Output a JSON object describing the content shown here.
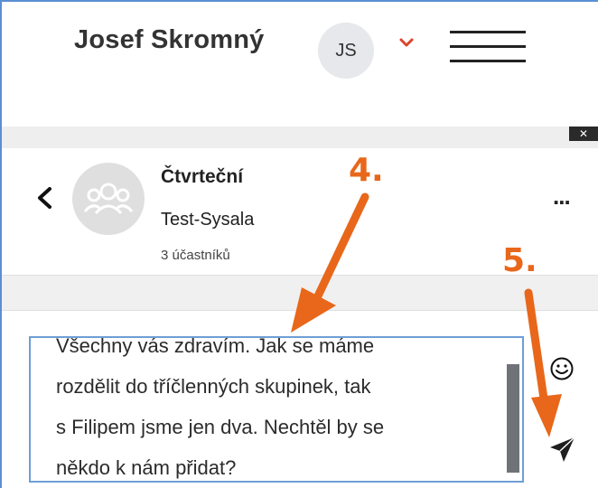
{
  "header": {
    "user_name": "Josef Skromný",
    "avatar_initials": "JS"
  },
  "chat": {
    "group_name": "Čtvrteční",
    "group_subtitle": "Test-Sysala",
    "participants": "3 účastníků",
    "more_label": "..."
  },
  "composer": {
    "text": "Všechny vás zdravím. Jak se máme\nrozdělit do tříčlenných skupinek, tak\ns Filipem jsme jen dva. Nechtěl by se\nněkdo k nám přidat?"
  },
  "annotations": {
    "step4": "4.",
    "step5": "5.",
    "color": "#e8671a"
  },
  "colors": {
    "accent": "#5b8fd4",
    "header_avatar_bg": "#e6e8eb",
    "chevron": "#d9442e"
  }
}
